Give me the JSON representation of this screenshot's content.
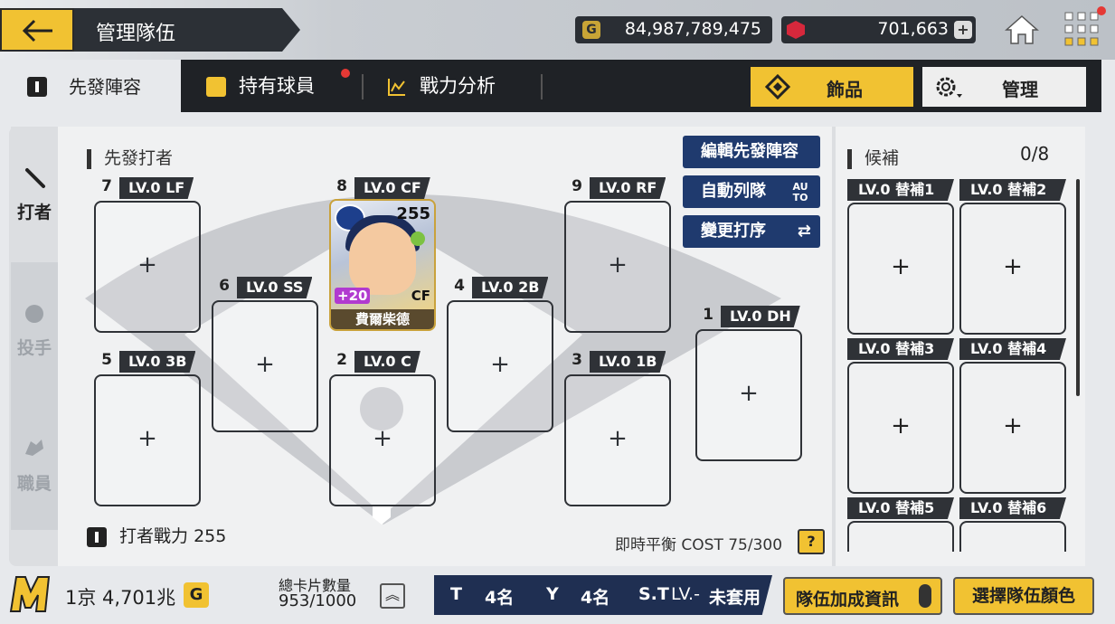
{
  "header": {
    "title": "管理隊伍",
    "gold": "84,987,789,475",
    "gems": "701,663"
  },
  "tabs": {
    "lineup": "先發陣容",
    "players": "持有球員",
    "analysis": "戰力分析",
    "accessories": "飾品",
    "manage": "管理"
  },
  "nav": {
    "batter": "打者",
    "pitcher": "投手",
    "coach": "職員"
  },
  "lineup": {
    "header": "先發打者",
    "edit_btn": "編輯先發陣容",
    "auto_btn": "自動列隊",
    "auto_icon": "AU TO",
    "order_btn": "變更打序",
    "slots": [
      {
        "num": "7",
        "label": "LV.0 LF",
        "plus": "+"
      },
      {
        "num": "8",
        "label": "LV.0 CF",
        "plus": ""
      },
      {
        "num": "9",
        "label": "LV.0 RF",
        "plus": "+"
      },
      {
        "num": "6",
        "label": "LV.0 SS",
        "plus": "+"
      },
      {
        "num": "4",
        "label": "LV.0 2B",
        "plus": "+"
      },
      {
        "num": "1",
        "label": "LV.0 DH",
        "plus": "+"
      },
      {
        "num": "5",
        "label": "LV.0 3B",
        "plus": "+"
      },
      {
        "num": "2",
        "label": "LV.0 C",
        "plus": "+"
      },
      {
        "num": "3",
        "label": "LV.0 1B",
        "plus": "+"
      }
    ],
    "card": {
      "overall": "255",
      "bonus": "+20",
      "position": "CF",
      "name": "費爾柴德"
    },
    "power_label": "打者戰力",
    "power_value": "255",
    "cost": "即時平衡 COST 75/300",
    "help": "?"
  },
  "bench": {
    "header": "候補",
    "count": "0/8",
    "slots": [
      "LV.0 替補1",
      "LV.0 替補2",
      "LV.0 替補3",
      "LV.0 替補4",
      "LV.0 替補5",
      "LV.0 替補6"
    ],
    "plus": "+"
  },
  "footer": {
    "money": "1京 4,701兆",
    "money_icon": "G",
    "cards_label": "總卡片數量",
    "cards_value": "953/1000",
    "team_t": "T",
    "team_t_val": "4名",
    "team_y": "Y",
    "team_y_val": "4名",
    "team_st": "S.T",
    "team_st_lv": "LV.-",
    "team_st_val": "未套用",
    "bonus_btn": "隊伍加成資訊",
    "color_btn": "選擇隊伍顏色"
  },
  "colors": {
    "accent": "#f1c232",
    "navy": "#1f3a6e",
    "dark": "#2f3237"
  },
  "icons": [
    "back-arrow-icon",
    "gold-coin-icon",
    "gem-icon",
    "home-icon",
    "menu-grid-icon",
    "bat-icon",
    "baseball-icon",
    "glove-icon"
  ]
}
